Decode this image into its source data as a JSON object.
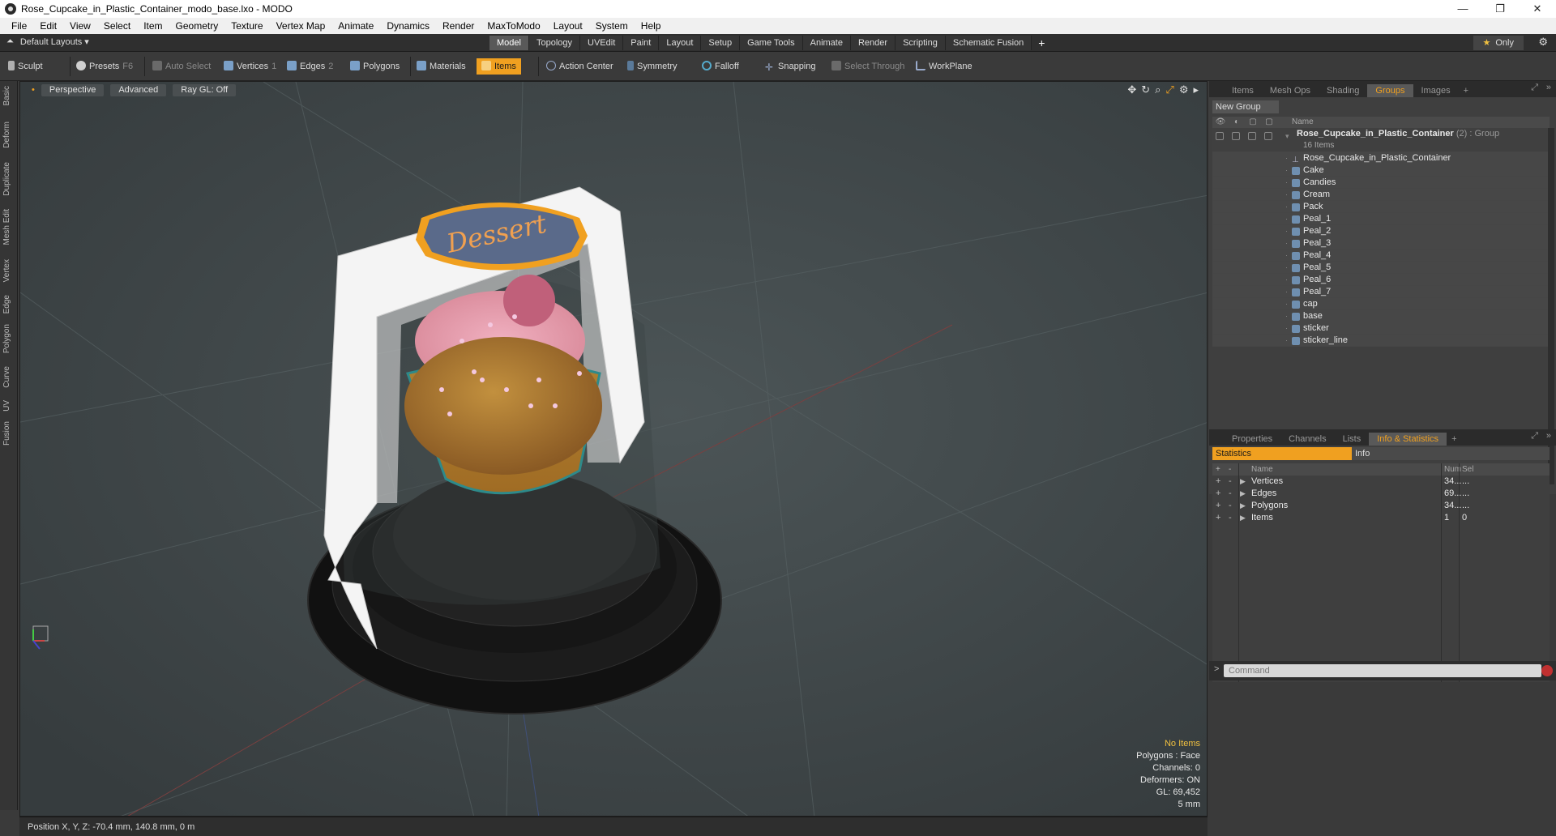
{
  "window": {
    "title": "Rose_Cupcake_in_Plastic_Container_modo_base.lxo - MODO",
    "controls": [
      "—",
      "❐",
      "✕"
    ]
  },
  "menu": [
    "File",
    "Edit",
    "View",
    "Select",
    "Item",
    "Geometry",
    "Texture",
    "Vertex Map",
    "Animate",
    "Dynamics",
    "Render",
    "MaxToModo",
    "Layout",
    "System",
    "Help"
  ],
  "layoutbar": {
    "layouts_label": "Default Layouts ▾",
    "tabs": [
      "Model",
      "Topology",
      "UVEdit",
      "Paint",
      "Layout",
      "Setup",
      "Game Tools",
      "Animate",
      "Render",
      "Scripting",
      "Schematic Fusion"
    ],
    "active_tab": "Model",
    "only_star": "★",
    "only_label": "Only"
  },
  "toolbar": {
    "sculpt": "Sculpt",
    "presets": "Presets",
    "presets_key": "F6",
    "auto_select": "Auto Select",
    "vertices": "Vertices",
    "vertices_key": "1",
    "edges": "Edges",
    "edges_key": "2",
    "polygons": "Polygons",
    "materials": "Materials",
    "items": "Items",
    "action_center": "Action Center",
    "symmetry": "Symmetry",
    "falloff": "Falloff",
    "snapping": "Snapping",
    "select_through": "Select Through",
    "workplane": "WorkPlane"
  },
  "left_tabs": [
    "Basic",
    "Deform",
    "Duplicate",
    "Mesh Edit",
    "Vertex",
    "Edge",
    "Polygon",
    "Curve",
    "UV",
    "Fusion"
  ],
  "viewport": {
    "view_mode": "Perspective",
    "shading": "Advanced",
    "raygl": "Ray GL: Off",
    "sticker_text": "Dessert",
    "info": {
      "no_items": "No Items",
      "polygons": "Polygons : Face",
      "channels": "Channels: 0",
      "deformers": "Deformers: ON",
      "gl": "GL: 69,452",
      "scale": "5 mm"
    }
  },
  "statusbar": {
    "position": "Position X, Y, Z:  -70.4 mm, 140.8 mm, 0 m"
  },
  "groups_panel": {
    "tabs": [
      "Items",
      "Mesh Ops",
      "Shading",
      "Groups",
      "Images"
    ],
    "active_tab": "Groups",
    "new_group": "New Group",
    "name_header": "Name",
    "root": {
      "name": "Rose_Cupcake_in_Plastic_Container",
      "suffix": "(2) : Group",
      "count": "16 Items"
    },
    "locator": "Rose_Cupcake_in_Plastic_Container",
    "meshes": [
      "Cake",
      "Candies",
      "Cream",
      "Pack",
      "Peal_1",
      "Peal_2",
      "Peal_3",
      "Peal_4",
      "Peal_5",
      "Peal_6",
      "Peal_7",
      "cap",
      "base",
      "sticker",
      "sticker_line"
    ]
  },
  "stats_panel": {
    "tabs": [
      "Properties",
      "Channels",
      "Lists",
      "Info & Statistics"
    ],
    "active_tab": "Info & Statistics",
    "subtabs": [
      "Statistics",
      "Info"
    ],
    "columns": [
      "Name",
      "Num",
      "Sel"
    ],
    "rows": [
      {
        "name": "Vertices",
        "num": "34...",
        "sel": "..."
      },
      {
        "name": "Edges",
        "num": "69...",
        "sel": "..."
      },
      {
        "name": "Polygons",
        "num": "34...",
        "sel": "..."
      },
      {
        "name": "Items",
        "num": "1",
        "sel": "0"
      }
    ]
  },
  "command": {
    "prompt": ">",
    "placeholder": "Command"
  }
}
